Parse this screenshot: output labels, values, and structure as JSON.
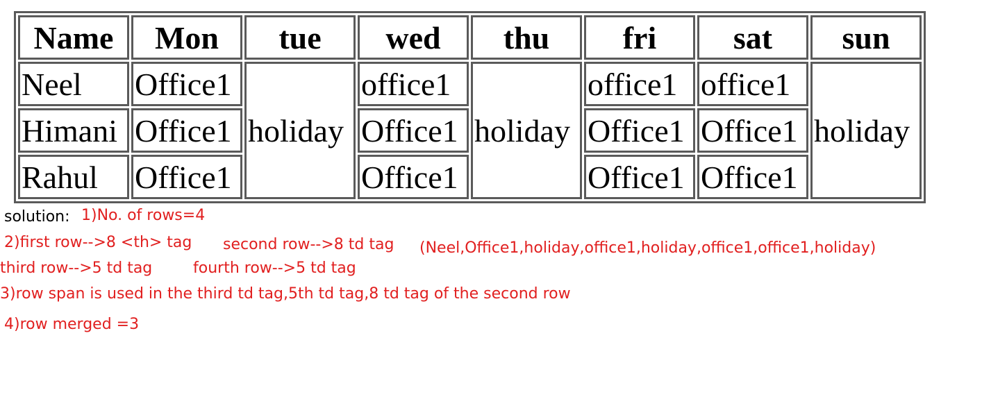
{
  "table": {
    "headers": [
      "Name",
      "Mon",
      "tue",
      "wed",
      "thu",
      "fri",
      "sat",
      "sun"
    ],
    "rows": [
      {
        "name": "Neel",
        "mon": "Office1",
        "tue": "holiday",
        "wed": "office1",
        "thu": "holiday",
        "fri": "office1",
        "sat": "office1",
        "sun": "holiday"
      },
      {
        "name": "Himani",
        "mon": "Office1",
        "wed": "Office1",
        "fri": "Office1",
        "sat": "Office1"
      },
      {
        "name": "Rahul",
        "mon": "Office1",
        "wed": "Office1",
        "fri": "Office1",
        "sat": "Office1"
      }
    ]
  },
  "notes": {
    "solution_label": "solution:",
    "line1": "1)No. of rows=4",
    "line2a": "2)first row-->8 <th> tag",
    "line2b": "second row-->8 td tag",
    "line2c": "(Neel,Office1,holiday,office1,holiday,office1,office1,holiday)",
    "line3a": "third row-->5 td tag",
    "line3b": "fourth row-->5 td tag",
    "line4": "3)row span is used in the third td tag,5th td tag,8 td tag of the second row",
    "line5": "4)row merged =3"
  },
  "colors": {
    "note_red": "#e11f1f",
    "border_gray": "#5a5a5a"
  }
}
